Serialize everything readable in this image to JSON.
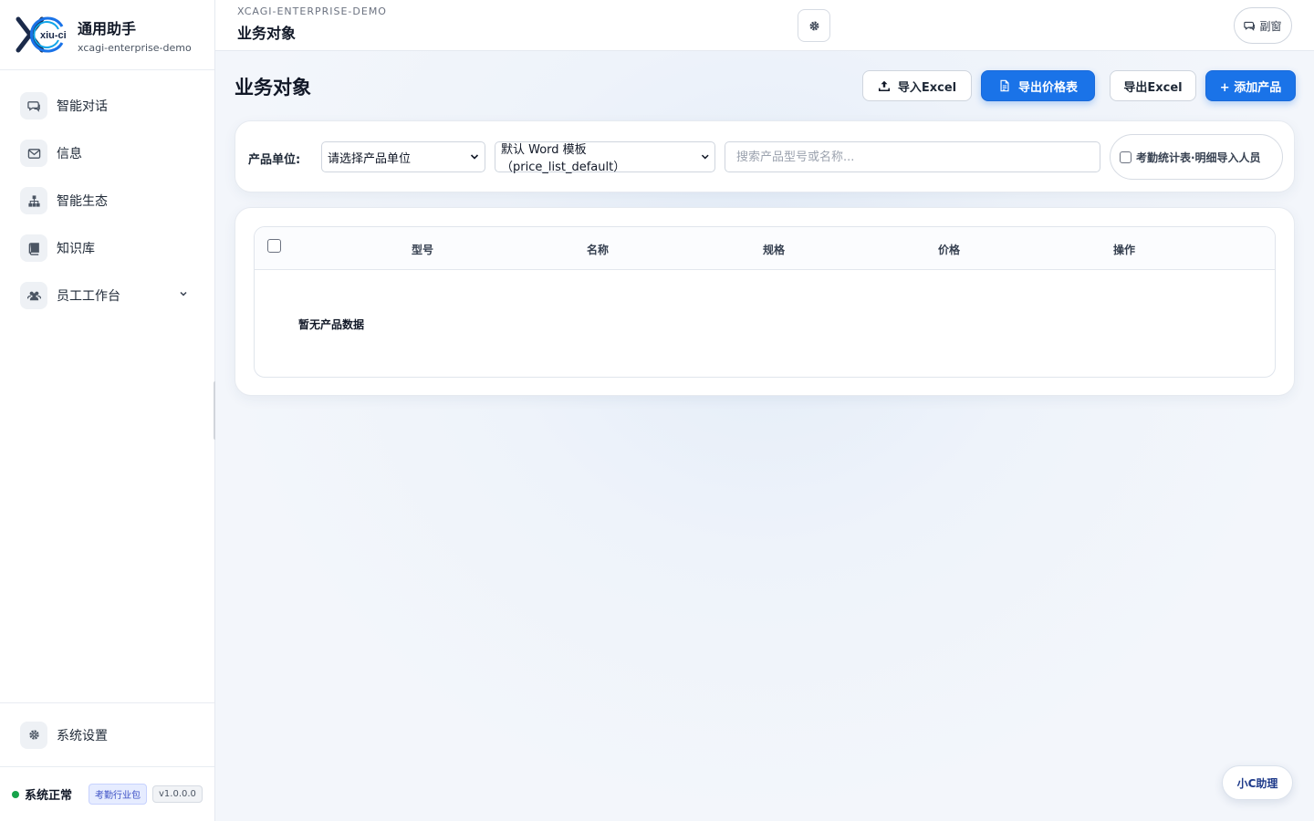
{
  "brand": {
    "title": "通用助手",
    "subtitle": "xcagi-enterprise-demo",
    "logo_text": "xiu-ci"
  },
  "sidebar": {
    "items": [
      {
        "label": "智能对话",
        "icon": "chat-icon"
      },
      {
        "label": "信息",
        "icon": "mail-icon"
      },
      {
        "label": "智能生态",
        "icon": "sitemap-icon"
      },
      {
        "label": "知识库",
        "icon": "book-icon"
      },
      {
        "label": "员工工作台",
        "icon": "users-icon",
        "expandable": true
      }
    ],
    "settings_label": "系统设置",
    "status_text": "系统正常",
    "pack_badge": "考勤行业包",
    "version_badge": "v1.0.0.0"
  },
  "topbar": {
    "subtitle": "XCAGI-ENTERPRISE-DEMO",
    "title": "业务对象",
    "sub_window_label": "副窗"
  },
  "main": {
    "page_title": "业务对象",
    "buttons": {
      "import_excel": "导入Excel",
      "export_price": "导出价格表",
      "export_excel": "导出Excel",
      "add_product": "+ 添加产品"
    },
    "filter": {
      "unit_label": "产品单位:",
      "unit_select": "请选择产品单位",
      "template_select": "默认 Word 模板（price_list_default）",
      "search_placeholder": "搜索产品型号或名称...",
      "checkbox_label": "考勤统计表·明细导入人员"
    },
    "table": {
      "columns": [
        "型号",
        "名称",
        "规格",
        "价格",
        "操作"
      ],
      "empty_text": "暂无产品数据"
    }
  },
  "assistant_label": "小C助理",
  "colors": {
    "primary": "#1a73e8",
    "status_ok": "#16a34a"
  }
}
